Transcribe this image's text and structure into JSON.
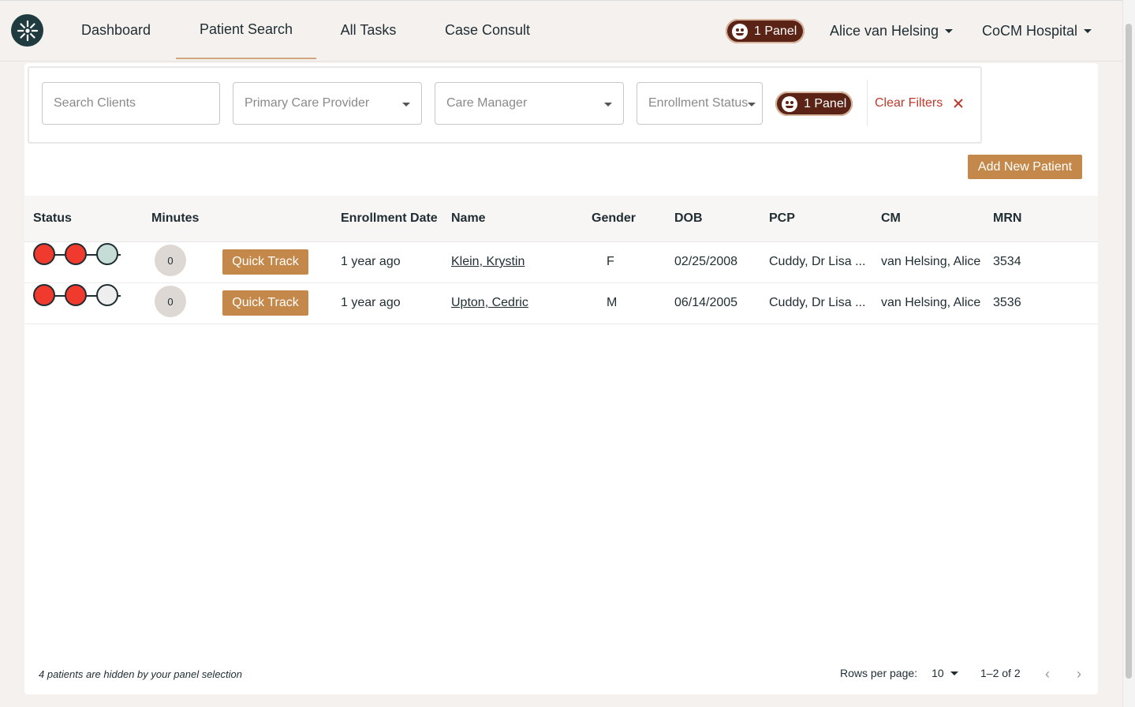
{
  "nav": {
    "tabs": [
      "Dashboard",
      "Patient Search",
      "All Tasks",
      "Case Consult"
    ],
    "active_tab": "Patient Search",
    "panel_label": "1 Panel",
    "user": "Alice van Helsing",
    "org": "CoCM Hospital"
  },
  "filters": {
    "search_placeholder": "Search Clients",
    "pcp_placeholder": "Primary Care Provider",
    "cm_placeholder": "Care Manager",
    "enrollment_placeholder": "Enrollment Status",
    "panel_label": "1 Panel",
    "clear_label": "Clear Filters"
  },
  "add_patient_label": "Add New Patient",
  "table": {
    "columns": [
      "Status",
      "Minutes",
      "Enrollment Date",
      "Name",
      "Gender",
      "DOB",
      "PCP",
      "CM",
      "MRN"
    ],
    "quick_track_label": "Quick Track",
    "rows": [
      {
        "status": [
          "red",
          "red",
          "teal"
        ],
        "minutes": "0",
        "enrollment": "1 year ago",
        "name": "Klein, Krystin",
        "gender": "F",
        "dob": "02/25/2008",
        "pcp": "Cuddy, Dr Lisa ...",
        "cm": "van Helsing, Alice",
        "mrn": "3534"
      },
      {
        "status": [
          "red",
          "red",
          "grey"
        ],
        "minutes": "0",
        "enrollment": "1 year ago",
        "name": "Upton, Cedric",
        "gender": "M",
        "dob": "06/14/2005",
        "pcp": "Cuddy, Dr Lisa ...",
        "cm": "van Helsing, Alice",
        "mrn": "3536"
      }
    ]
  },
  "status_colors": {
    "red": "#f03a2e",
    "teal": "#c5ddd6",
    "grey": "#eeeeee"
  },
  "footer": {
    "hidden_note": "4 patients are hidden by your panel selection",
    "rows_per_page_label": "Rows per page:",
    "rows_per_page_value": "10",
    "range": "1–2 of 2"
  }
}
